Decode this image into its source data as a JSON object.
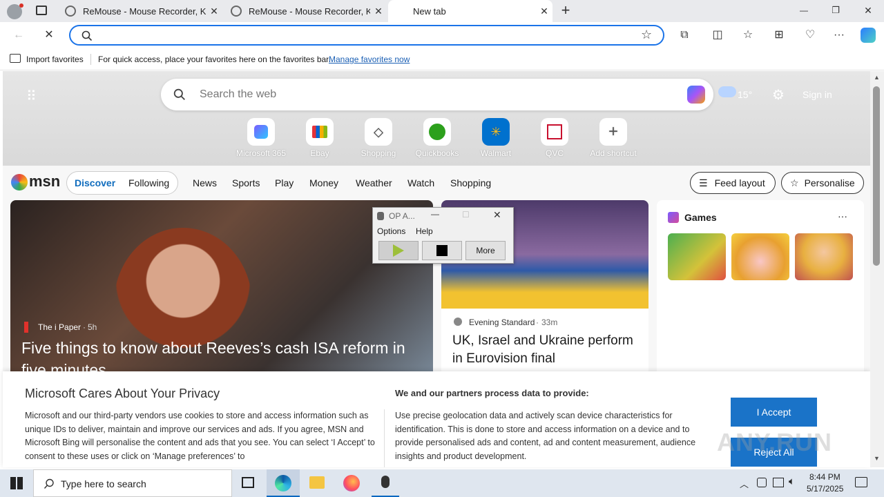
{
  "tabs": [
    {
      "title": "ReMouse - Mouse Recorder, Keyb",
      "close": "✕"
    },
    {
      "title": "ReMouse - Mouse Recorder, Keyb",
      "close": "✕"
    },
    {
      "title": "New tab",
      "close": "✕"
    }
  ],
  "new_tab_symbol": "+",
  "window_controls": {
    "minimize": "—",
    "restore": "❐",
    "close": "✕"
  },
  "address_bar": {
    "value": "",
    "placeholder": ""
  },
  "favorites_bar": {
    "import_label": "Import favorites",
    "hint": "For quick access, place your favorites here on the favorites bar.",
    "manage_link": "Manage favorites now"
  },
  "newtab": {
    "search_placeholder": "Search the web",
    "temperature": "15°",
    "sign_in": "Sign in",
    "shortcuts": [
      {
        "label": "Microsoft 365",
        "icon": "m365-icon",
        "color": "#7a5cff"
      },
      {
        "label": "Ebay",
        "icon": "ebay-icon",
        "color": "#e53238"
      },
      {
        "label": "Shopping",
        "icon": "shopping-tag-icon",
        "color": "#333333"
      },
      {
        "label": "Quickbooks",
        "icon": "quickbooks-icon",
        "color": "#2ca01c"
      },
      {
        "label": "Walmart",
        "icon": "walmart-icon",
        "color": "#0071ce"
      },
      {
        "label": "QVC",
        "icon": "qvc-icon",
        "color": "#c8102e"
      },
      {
        "label": "Add shortcut",
        "icon": "plus-icon",
        "color": "#555555"
      }
    ]
  },
  "msn": {
    "logo_text": "msn",
    "discover": "Discover",
    "following": "Following",
    "nav": [
      "News",
      "Sports",
      "Play",
      "Money",
      "Weather",
      "Watch",
      "Shopping"
    ],
    "feed_layout": "Feed layout",
    "personalise": "Personalise"
  },
  "cards": {
    "main": {
      "source": "The i Paper",
      "time": "5h",
      "headline": "Five things to know about Reeves’s cash ISA reform in five minutes"
    },
    "second": {
      "source": "Evening Standard",
      "time": "33m",
      "headline": "UK, Israel and Ukraine perform in Eurovision final"
    },
    "games": {
      "title": "Games",
      "more": "···"
    }
  },
  "popup": {
    "title": "OP A...",
    "menu": [
      "Options",
      "Help"
    ],
    "more_label": "More"
  },
  "privacy": {
    "title": "Microsoft Cares About Your Privacy",
    "body": "Microsoft and our third-party vendors use cookies to store and access information such as unique IDs to deliver, maintain and improve our services and ads. If you agree, MSN and Microsoft Bing will personalise the content and ads that you see. You can select ‘I Accept’ to consent to these uses or click on ‘Manage preferences’ to",
    "partners_title": "We and our partners process data to provide:",
    "partners_body": "Use precise geolocation data and actively scan device characteristics for identification. This is done to store and access information on a device and to provide personalised ads and content, ad and content measurement, audience insights and product development.",
    "accept": "I Accept",
    "reject": "Reject All"
  },
  "watermark": "ANY.RUN",
  "taskbar": {
    "search_placeholder": "Type here to search",
    "time": "8:44 PM",
    "date": "5/17/2025"
  },
  "colors": {
    "accent": "#1a73e8",
    "msn_blue": "#0f6cbd",
    "accept_blue": "#1a73c8"
  }
}
